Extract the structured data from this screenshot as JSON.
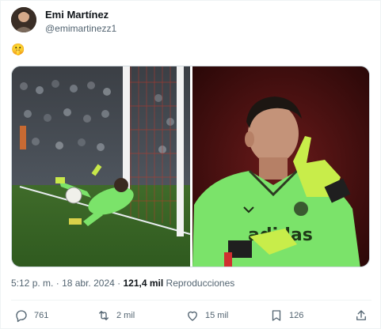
{
  "author": {
    "display_name": "Emi Martínez",
    "handle": "@emimartinezz1"
  },
  "tweet": {
    "text": "🤫"
  },
  "media": {
    "left_image": "goalkeeper-diving-save-photo",
    "right_image": "goalkeeper-shush-gesture-photo",
    "jersey_text": "adidas"
  },
  "meta": {
    "time": "5:12 p. m.",
    "separator": "·",
    "date": "18 abr. 2024",
    "views_count": "121,4 mil",
    "views_label": "Reproducciones"
  },
  "actions": {
    "replies": "761",
    "reposts": "2 mil",
    "likes": "15 mil",
    "bookmarks": "126"
  },
  "colors": {
    "keeper_green": "#7be36a",
    "text_primary": "#0f1419",
    "text_secondary": "#536471"
  }
}
